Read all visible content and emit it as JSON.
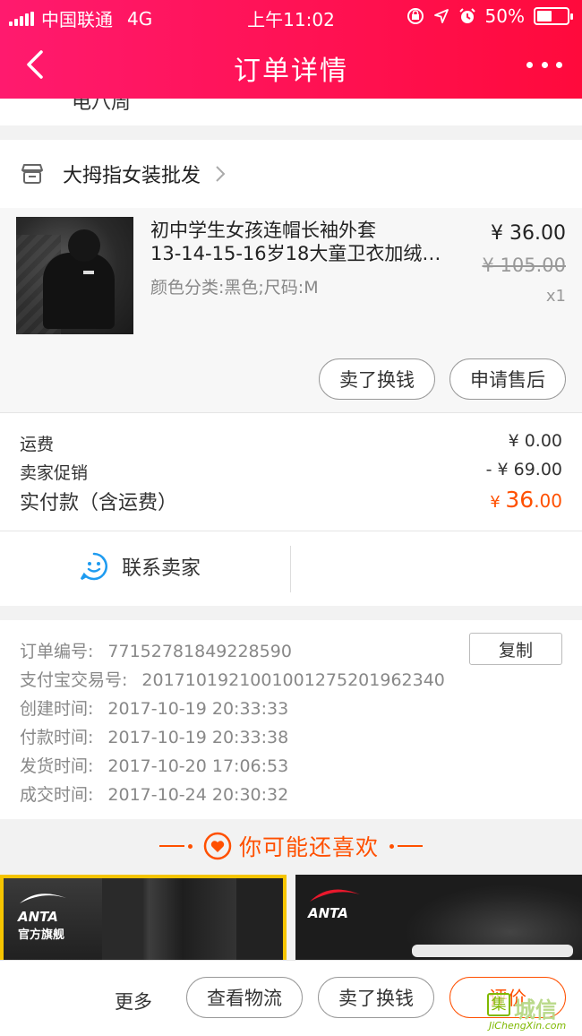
{
  "status_bar": {
    "carrier": "中国联通",
    "network": "4G",
    "time": "上午11:02",
    "battery": "50%",
    "battery_level": 0.5
  },
  "nav": {
    "title": "订单详情"
  },
  "partial_text": "电八周",
  "shop": {
    "name": "大拇指女装批发"
  },
  "item": {
    "title_line1": "初中学生女孩连帽长袖外套",
    "title_line2": "13-14-15-16岁18大童卫衣加绒…",
    "sku": "颜色分类:黑色;尺码:M",
    "price": "¥ 36.00",
    "original_price": "¥ 105.00",
    "quantity": "x1",
    "btn_sell": "卖了换钱",
    "btn_after_sale": "申请售后"
  },
  "fees": {
    "shipping_label": "运费",
    "shipping_value": "¥ 0.00",
    "promo_label": "卖家促销",
    "promo_value": "- ¥ 69.00",
    "total_label": "实付款（含运费）",
    "total_currency": "¥ ",
    "total_int": "36",
    "total_dec": ".00"
  },
  "contact": {
    "label": "联系卖家"
  },
  "order_info": {
    "order_no_label": "订单编号:",
    "order_no": "77152781849228590",
    "copy_label": "复制",
    "alipay_label": "支付宝交易号:",
    "alipay_no": "2017101921001001275201962340",
    "created_label": "创建时间:",
    "created": "2017-10-19 20:33:33",
    "paid_label": "付款时间:",
    "paid": "2017-10-19 20:33:38",
    "shipped_label": "发货时间:",
    "shipped": "2017-10-20 17:06:53",
    "closed_label": "成交时间:",
    "closed": "2017-10-24 20:30:32"
  },
  "recommend": {
    "title": "你可能还喜欢",
    "brand1": "ANTA",
    "brand1_sub": "官方旗舰",
    "brand2": "ANTA"
  },
  "bottom_bar": {
    "more": "更多",
    "logistics": "查看物流",
    "sell": "卖了换钱",
    "rate": "评价"
  },
  "watermark": {
    "box": "集",
    "text": "城信",
    "sub": "JiChengXin.com"
  },
  "colors": {
    "header_start": "#ff1a6e",
    "header_end": "#ff0a3c",
    "accent": "#ff5000"
  }
}
